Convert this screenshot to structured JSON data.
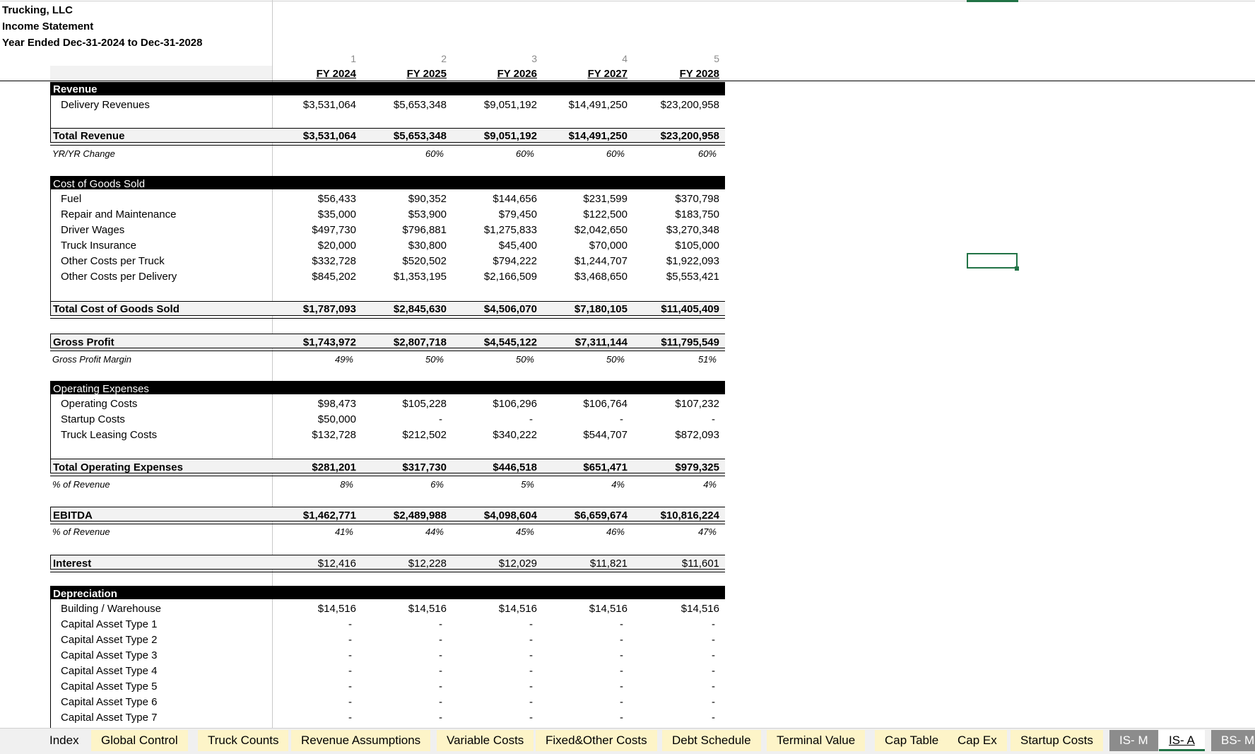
{
  "company": {
    "name": "Trucking, LLC",
    "statement": "Income Statement",
    "period": "Year Ended Dec-31-2024 to Dec-31-2028"
  },
  "columns": {
    "numbers": [
      "1",
      "2",
      "3",
      "4",
      "5"
    ],
    "years": [
      "FY 2024",
      "FY 2025",
      "FY 2026",
      "FY 2027",
      "FY 2028"
    ]
  },
  "revenue": {
    "header": "Revenue",
    "items": [
      {
        "label": "Delivery Revenues",
        "values": [
          "$3,531,064",
          "$5,653,348",
          "$9,051,192",
          "$14,491,250",
          "$23,200,958"
        ]
      }
    ],
    "total_label": "Total Revenue",
    "total_values": [
      "$3,531,064",
      "$5,653,348",
      "$9,051,192",
      "$14,491,250",
      "$23,200,958"
    ],
    "change_label": "YR/YR Change",
    "change_values": [
      "",
      "60%",
      "60%",
      "60%",
      "60%"
    ]
  },
  "cogs": {
    "header": "Cost of Goods Sold",
    "items": [
      {
        "label": "Fuel",
        "values": [
          "$56,433",
          "$90,352",
          "$144,656",
          "$231,599",
          "$370,798"
        ]
      },
      {
        "label": "Repair and Maintenance",
        "values": [
          "$35,000",
          "$53,900",
          "$79,450",
          "$122,500",
          "$183,750"
        ]
      },
      {
        "label": "Driver Wages",
        "values": [
          "$497,730",
          "$796,881",
          "$1,275,833",
          "$2,042,650",
          "$3,270,348"
        ]
      },
      {
        "label": "Truck Insurance",
        "values": [
          "$20,000",
          "$30,800",
          "$45,400",
          "$70,000",
          "$105,000"
        ]
      },
      {
        "label": "Other Costs per Truck",
        "values": [
          "$332,728",
          "$520,502",
          "$794,222",
          "$1,244,707",
          "$1,922,093"
        ]
      },
      {
        "label": "Other Costs per Delivery",
        "values": [
          "$845,202",
          "$1,353,195",
          "$2,166,509",
          "$3,468,650",
          "$5,553,421"
        ]
      }
    ],
    "total_label": "Total Cost of Goods Sold",
    "total_values": [
      "$1,787,093",
      "$2,845,630",
      "$4,506,070",
      "$7,180,105",
      "$11,405,409"
    ]
  },
  "gross": {
    "label": "Gross Profit",
    "values": [
      "$1,743,972",
      "$2,807,718",
      "$4,545,122",
      "$7,311,144",
      "$11,795,549"
    ],
    "margin_label": "Gross Profit Margin",
    "margin_values": [
      "49%",
      "50%",
      "50%",
      "50%",
      "51%"
    ]
  },
  "opex": {
    "header": "Operating Expenses",
    "items": [
      {
        "label": "Operating Costs",
        "values": [
          "$98,473",
          "$105,228",
          "$106,296",
          "$106,764",
          "$107,232"
        ]
      },
      {
        "label": "Startup Costs",
        "values": [
          "$50,000",
          "-",
          "-",
          "-",
          "-"
        ]
      },
      {
        "label": "Truck Leasing Costs",
        "values": [
          "$132,728",
          "$212,502",
          "$340,222",
          "$544,707",
          "$872,093"
        ]
      }
    ],
    "total_label": "Total Operating Expenses",
    "total_values": [
      "$281,201",
      "$317,730",
      "$446,518",
      "$651,471",
      "$979,325"
    ],
    "pct_label": "% of Revenue",
    "pct_values": [
      "8%",
      "6%",
      "5%",
      "4%",
      "4%"
    ]
  },
  "ebitda": {
    "label": "EBITDA",
    "values": [
      "$1,462,771",
      "$2,489,988",
      "$4,098,604",
      "$6,659,674",
      "$10,816,224"
    ],
    "pct_label": "% of Revenue",
    "pct_values": [
      "41%",
      "44%",
      "45%",
      "46%",
      "47%"
    ]
  },
  "interest": {
    "label": "Interest",
    "values": [
      "$12,416",
      "$12,228",
      "$12,029",
      "$11,821",
      "$11,601"
    ]
  },
  "depreciation": {
    "header": "Depreciation",
    "items": [
      {
        "label": "Building / Warehouse",
        "values": [
          "$14,516",
          "$14,516",
          "$14,516",
          "$14,516",
          "$14,516"
        ]
      },
      {
        "label": "Capital Asset Type 1",
        "values": [
          "-",
          "-",
          "-",
          "-",
          "-"
        ]
      },
      {
        "label": "Capital Asset Type 2",
        "values": [
          "-",
          "-",
          "-",
          "-",
          "-"
        ]
      },
      {
        "label": "Capital Asset Type 3",
        "values": [
          "-",
          "-",
          "-",
          "-",
          "-"
        ]
      },
      {
        "label": "Capital Asset Type 4",
        "values": [
          "-",
          "-",
          "-",
          "-",
          "-"
        ]
      },
      {
        "label": "Capital Asset Type 5",
        "values": [
          "-",
          "-",
          "-",
          "-",
          "-"
        ]
      },
      {
        "label": "Capital Asset Type 6",
        "values": [
          "-",
          "-",
          "-",
          "-",
          "-"
        ]
      },
      {
        "label": "Capital Asset Type 7",
        "values": [
          "-",
          "-",
          "-",
          "-",
          "-"
        ]
      }
    ]
  },
  "tabs": [
    {
      "label": "Index",
      "style": "plain"
    },
    {
      "label": "Global Control",
      "style": "yel"
    },
    {
      "label": "Truck Counts",
      "style": "yel"
    },
    {
      "label": "Revenue Assumptions",
      "style": "yel"
    },
    {
      "label": "Variable Costs",
      "style": "yel"
    },
    {
      "label": "Fixed&Other Costs",
      "style": "yel"
    },
    {
      "label": "Debt Schedule",
      "style": "yel"
    },
    {
      "label": "Terminal Value",
      "style": "yel"
    },
    {
      "label": "Cap Table",
      "style": "yel"
    },
    {
      "label": "Cap Ex",
      "style": "yel"
    },
    {
      "label": "Startup Costs",
      "style": "yel"
    },
    {
      "label": "IS- M",
      "style": "gray"
    },
    {
      "label": "IS- A",
      "style": "active"
    },
    {
      "label": "BS- M",
      "style": "gray"
    }
  ]
}
